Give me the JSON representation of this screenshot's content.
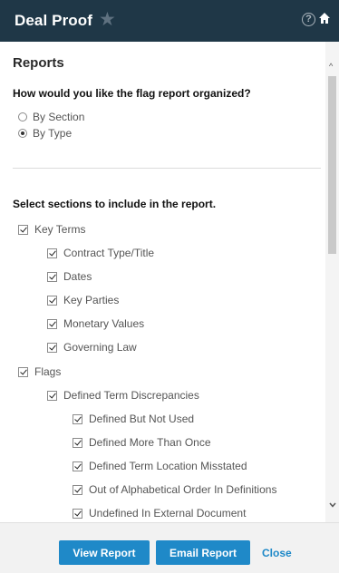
{
  "header": {
    "title": "Deal Proof",
    "help_icon": "?"
  },
  "panel": {
    "title": "Reports",
    "organize": {
      "question": "How would you like the flag report organized?",
      "options": [
        {
          "label": "By Section",
          "selected": false
        },
        {
          "label": "By Type",
          "selected": true
        }
      ]
    },
    "sections_prompt": "Select sections to include in the report.",
    "sections": [
      {
        "label": "Key Terms",
        "checked": true,
        "level": 0
      },
      {
        "label": "Contract Type/Title",
        "checked": true,
        "level": 1
      },
      {
        "label": "Dates",
        "checked": true,
        "level": 1
      },
      {
        "label": "Key Parties",
        "checked": true,
        "level": 1
      },
      {
        "label": "Monetary Values",
        "checked": true,
        "level": 1
      },
      {
        "label": "Governing Law",
        "checked": true,
        "level": 1
      },
      {
        "label": "Flags",
        "checked": true,
        "level": 0
      },
      {
        "label": "Defined Term Discrepancies",
        "checked": true,
        "level": 1
      },
      {
        "label": "Defined But Not Used",
        "checked": true,
        "level": 2
      },
      {
        "label": "Defined More Than Once",
        "checked": true,
        "level": 2
      },
      {
        "label": "Defined Term Location Misstated",
        "checked": true,
        "level": 2
      },
      {
        "label": "Out of Alphabetical Order In Definitions",
        "checked": true,
        "level": 2
      },
      {
        "label": "Undefined In External Document",
        "checked": true,
        "level": 2
      }
    ]
  },
  "footer": {
    "view_report": "View Report",
    "email_report": "Email Report",
    "close": "Close"
  },
  "colors": {
    "header_bg": "#1f3747",
    "button_bg": "#1f89c8",
    "link": "#1f89c8"
  }
}
